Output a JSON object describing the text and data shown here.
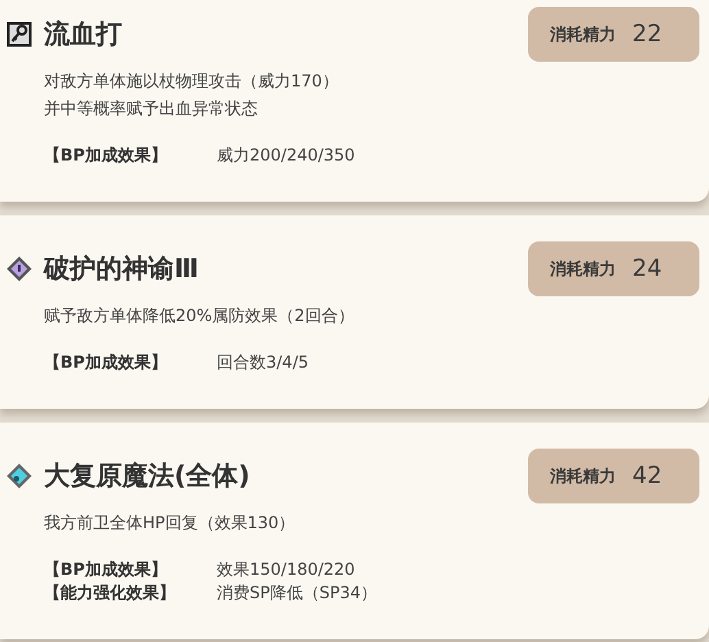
{
  "skills": [
    {
      "name": "流血打",
      "cost_label": "消耗精力",
      "cost": "22",
      "description": [
        "对敌方单体施以杖物理攻击（威力170）",
        "并中等概率赋予出血异常状态"
      ],
      "effects": [
        {
          "label": "【BP加成效果】",
          "value": "威力200/240/350"
        }
      ]
    },
    {
      "name": "破护的神谕Ⅲ",
      "cost_label": "消耗精力",
      "cost": "24",
      "description": [
        "赋予敌方单体降低20%属防效果（2回合）"
      ],
      "effects": [
        {
          "label": "【BP加成效果】",
          "value": "回合数3/4/5"
        }
      ]
    },
    {
      "name": "大复原魔法(全体)",
      "cost_label": "消耗精力",
      "cost": "42",
      "description": [
        "我方前卫全体HP回复（效果130）"
      ],
      "effects": [
        {
          "label": "【BP加成效果】",
          "value": "效果150/180/220"
        },
        {
          "label": "【能力强化效果】",
          "value": "消费SP降低（SP34）"
        }
      ]
    }
  ]
}
